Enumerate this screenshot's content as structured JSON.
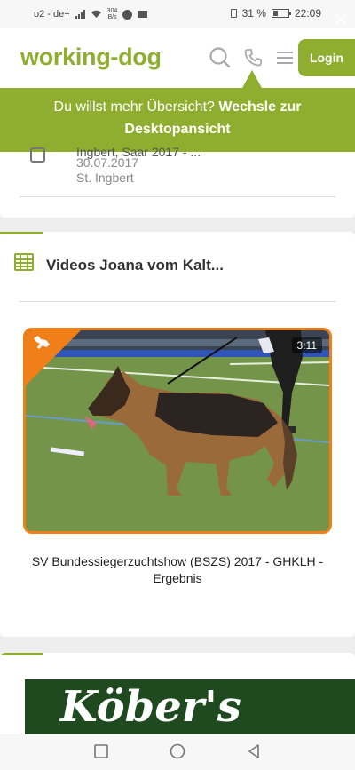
{
  "status_bar": {
    "carrier": "o2 - de+",
    "speed_value": "304",
    "speed_unit": "B/s",
    "battery_percent": "31 %",
    "time": "22:09"
  },
  "header": {
    "logo": "working-dog",
    "login_label": "Login",
    "icons": [
      "search-icon",
      "phone-icon",
      "menu-icon"
    ]
  },
  "banner": {
    "text": "Du willst mehr Übersicht?",
    "link_text": "Wechsle zur Desktopansicht",
    "close_icon": "close-icon"
  },
  "event": {
    "title_partial": "Ingbert, Saar 2017 - ...",
    "date": "30.07.2017",
    "location": "St. Ingbert"
  },
  "videos": {
    "title": "Videos Joana vom Kalt...",
    "items": [
      {
        "duration": "3:11",
        "caption": "SV Bundessiegerzuchtshow (BSZS) 2017 - GHKLH - Ergebnis"
      }
    ]
  },
  "ad": {
    "text": "Köber's"
  },
  "colors": {
    "brand_green": "#8fae2f",
    "video_border": "#f07f1a"
  }
}
